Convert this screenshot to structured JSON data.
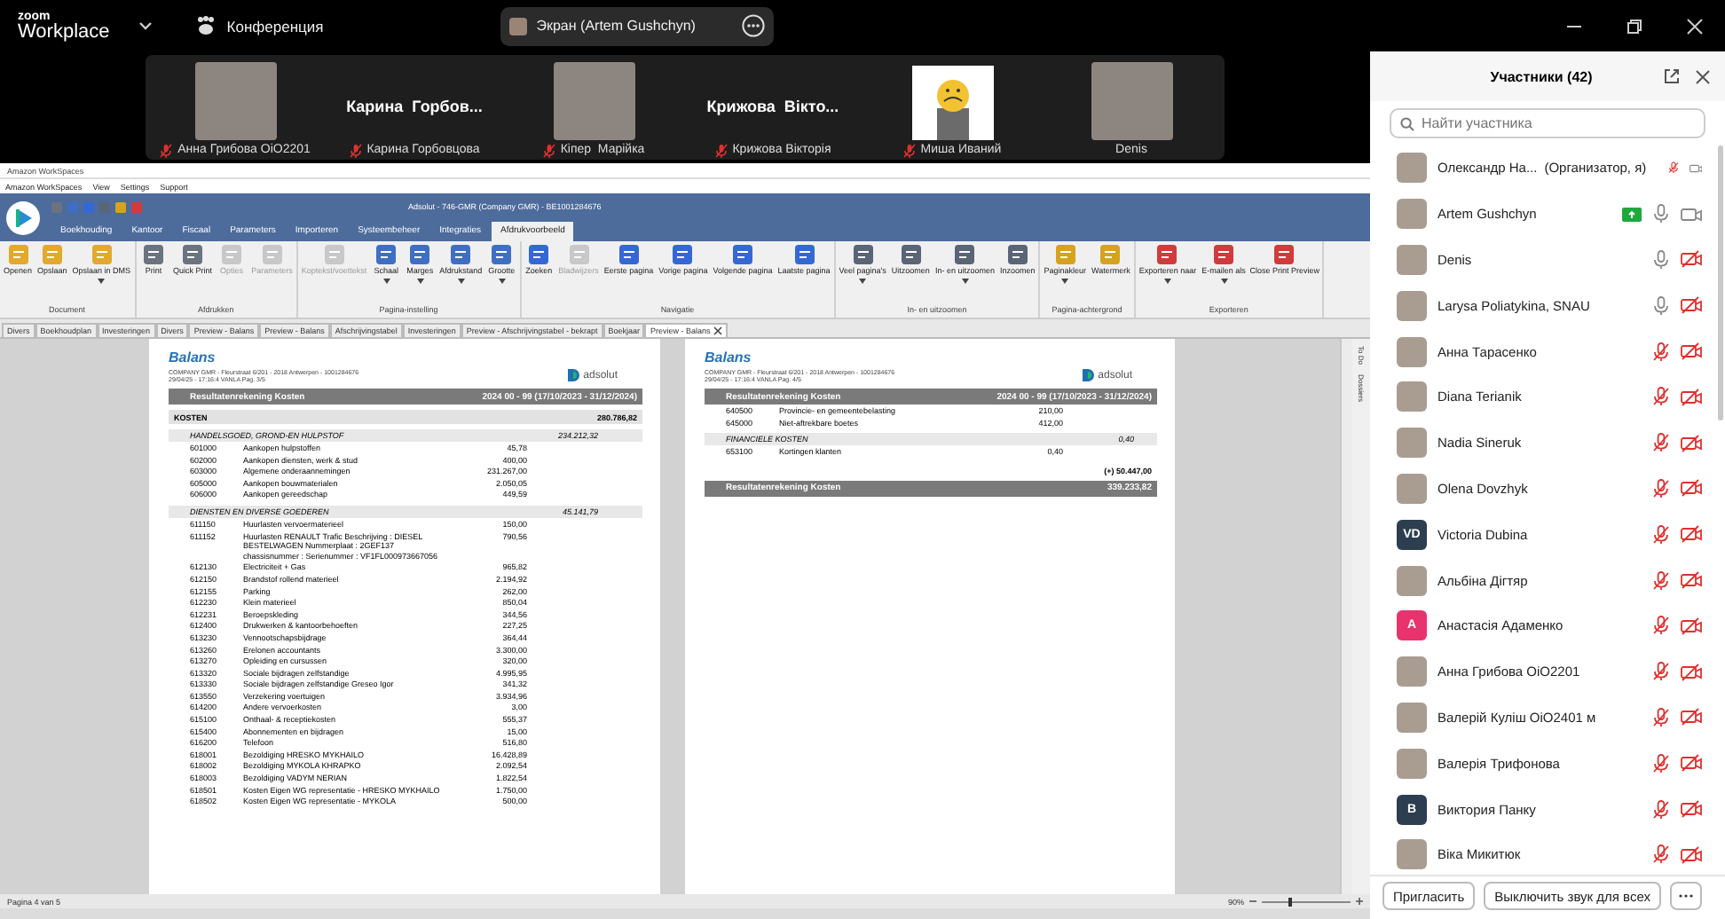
{
  "zoom_bar": {
    "brand_top": "zoom",
    "brand_bottom": "Workplace",
    "meeting_label": "Конференция",
    "share_label": "Экран (Artem Gushchyn)"
  },
  "video_tiles": [
    {
      "kind": "photo",
      "name": "Анна Грибова OiO2201",
      "muted": true
    },
    {
      "kind": "name_card",
      "title": "Карина  Горбов...",
      "name": "Карина Горбовцова",
      "muted": true
    },
    {
      "kind": "photo",
      "name": "Кіпер  Марійка",
      "muted": true
    },
    {
      "kind": "name_card",
      "title": "Крижова  Вікто...",
      "name": "Крижова Вікторія",
      "muted": true
    },
    {
      "kind": "avatar",
      "name": "Миша Иваний",
      "muted": true
    },
    {
      "kind": "photo",
      "name": "Denis",
      "muted": false
    }
  ],
  "workspaces": {
    "title": "Amazon WorkSpaces",
    "menu": [
      "Amazon WorkSpaces",
      "View",
      "Settings",
      "Support"
    ]
  },
  "app": {
    "title": "Adsolut - 746-GMR (Company GMR) - BE1001284676",
    "tabs": [
      {
        "label": "Boekhouding",
        "selected": false
      },
      {
        "label": "Kantoor",
        "selected": false
      },
      {
        "label": "Fiscaal",
        "selected": false
      },
      {
        "label": "Parameters",
        "selected": false
      },
      {
        "label": "Importeren",
        "selected": false
      },
      {
        "label": "Systeembeheer",
        "selected": false
      },
      {
        "label": "Integraties",
        "selected": false
      },
      {
        "label": "Afdrukvoorbeeld",
        "selected": true
      }
    ],
    "ribbon_groups": [
      {
        "label": "Document",
        "buttons": [
          {
            "label": "Openen",
            "disabled": false,
            "menu": false
          },
          {
            "label": "Opslaan",
            "disabled": false,
            "menu": false
          },
          {
            "label": "Opslaan in DMS",
            "disabled": false,
            "menu": true
          }
        ]
      },
      {
        "label": "Afdrukken",
        "buttons": [
          {
            "label": "Print",
            "disabled": false,
            "menu": false
          },
          {
            "label": "Quick Print",
            "disabled": false,
            "menu": false
          },
          {
            "label": "Opties",
            "disabled": true,
            "menu": false
          },
          {
            "label": "Parameters",
            "disabled": true,
            "menu": false
          }
        ]
      },
      {
        "label": "Pagina-instelling",
        "buttons": [
          {
            "label": "Koptekst/voettekst",
            "disabled": true,
            "menu": false
          },
          {
            "label": "Schaal",
            "disabled": false,
            "menu": true
          },
          {
            "label": "Marges",
            "disabled": false,
            "menu": true
          },
          {
            "label": "Afdrukstand",
            "disabled": false,
            "menu": true
          },
          {
            "label": "Grootte",
            "disabled": false,
            "menu": true
          }
        ]
      },
      {
        "label": "Navigatie",
        "buttons": [
          {
            "label": "Zoeken",
            "disabled": false,
            "menu": false
          },
          {
            "label": "Bladwijzers",
            "disabled": true,
            "menu": false
          },
          {
            "label": "Eerste pagina",
            "disabled": false,
            "menu": false
          },
          {
            "label": "Vorige pagina",
            "disabled": false,
            "menu": false
          },
          {
            "label": "Volgende pagina",
            "disabled": false,
            "menu": false
          },
          {
            "label": "Laatste pagina",
            "disabled": false,
            "menu": false
          }
        ]
      },
      {
        "label": "In- en uitzoomen",
        "buttons": [
          {
            "label": "Veel pagina's",
            "disabled": false,
            "menu": true
          },
          {
            "label": "Uitzoomen",
            "disabled": false,
            "menu": false
          },
          {
            "label": "In- en uitzoomen",
            "disabled": false,
            "menu": true
          },
          {
            "label": "Inzoomen",
            "disabled": false,
            "menu": false
          }
        ]
      },
      {
        "label": "Pagina-achtergrond",
        "buttons": [
          {
            "label": "Paginakleur",
            "disabled": false,
            "menu": true
          },
          {
            "label": "Watermerk",
            "disabled": false,
            "menu": false
          }
        ]
      },
      {
        "label": "Exporteren",
        "buttons": [
          {
            "label": "Exporteren naar",
            "disabled": false,
            "menu": true
          },
          {
            "label": "E-mailen als",
            "disabled": false,
            "menu": true
          },
          {
            "label": "Close Print Preview",
            "disabled": false,
            "menu": false
          }
        ]
      }
    ],
    "doc_tabs": [
      {
        "label": "Divers",
        "selected": false
      },
      {
        "label": "Boekhoudplan",
        "selected": false
      },
      {
        "label": "Investeringen",
        "selected": false
      },
      {
        "label": "Divers",
        "selected": false
      },
      {
        "label": "Preview - Balans",
        "selected": false
      },
      {
        "label": "Preview - Balans",
        "selected": false
      },
      {
        "label": "Afschrijvingstabel",
        "selected": false
      },
      {
        "label": "Investeringen",
        "selected": false
      },
      {
        "label": "Preview - Afschrijvingstabel - bekrapt",
        "selected": false
      },
      {
        "label": "Boekjaar",
        "selected": false
      },
      {
        "label": "Preview - Balans",
        "selected": true
      }
    ],
    "pages": [
      {
        "title": "Balans",
        "address": "COMPANY GMR  -  Fleurstraat 6/201  -  2018 Antwerpen  -  1001284676",
        "meta": "29/04/25  -  17:16:4     VANLA     Pag. 3/5",
        "logo": "adsolut",
        "lines": [
          {
            "kind": "band",
            "label": "Resultatenrekening Kosten",
            "value": "2024  00 - 99 (17/10/2023 - 31/12/2024)"
          },
          {
            "kind": "total",
            "label": "KOSTEN",
            "value": "280.786,82"
          },
          {
            "kind": "section",
            "label": "HANDELSGOED, GROND-EN HULPSTOF",
            "value": "234.212,32"
          },
          {
            "kind": "row",
            "code": "601000",
            "label": "Aankopen hulpstoffen",
            "amount": "45,78"
          },
          {
            "kind": "row",
            "code": "602000",
            "label": "Aankopen diensten, werk & stud",
            "amount": "400,00"
          },
          {
            "kind": "row",
            "code": "603000",
            "label": "Algemene onderaannemingen",
            "amount": "231.267,00"
          },
          {
            "kind": "row",
            "code": "605000",
            "label": "Aankopen bouwmaterialen",
            "amount": "2.050,05"
          },
          {
            "kind": "row",
            "code": "606000",
            "label": "Aankopen gereedschap",
            "amount": "449,59"
          },
          {
            "kind": "section",
            "label": "DIENSTEN EN DIVERSE GOEDEREN",
            "value": "45.141,79"
          },
          {
            "kind": "row",
            "code": "611150",
            "label": "Huurlasten vervoermaterieel",
            "amount": "150,00"
          },
          {
            "kind": "row",
            "code": "611152",
            "label": "Huurlasten RENAULT Trafic Beschrijving : DIESEL BESTELWAGEN Nummerplaat : 2GEF137 chassisnummer : Serienummer : VF1FL000973667056",
            "amount": "790,56"
          },
          {
            "kind": "row",
            "code": "612130",
            "label": "Electriciteit + Gas",
            "amount": "965,82"
          },
          {
            "kind": "row",
            "code": "612150",
            "label": "Brandstof rollend materieel",
            "amount": "2.194,92"
          },
          {
            "kind": "row",
            "code": "612155",
            "label": "Parking",
            "amount": "262,00"
          },
          {
            "kind": "row",
            "code": "612230",
            "label": "Klein materieel",
            "amount": "850,04"
          },
          {
            "kind": "row",
            "code": "612231",
            "label": "Beroepskleding",
            "amount": "344,56"
          },
          {
            "kind": "row",
            "code": "612400",
            "label": "Drukwerken & kantoorbehoeften",
            "amount": "227,25"
          },
          {
            "kind": "row",
            "code": "613230",
            "label": "Vennootschapsbijdrage",
            "amount": "364,44"
          },
          {
            "kind": "row",
            "code": "613260",
            "label": "Erelonen accountants",
            "amount": "3.300,00"
          },
          {
            "kind": "row",
            "code": "613270",
            "label": "Opleiding en cursussen",
            "amount": "320,00"
          },
          {
            "kind": "row",
            "code": "613320",
            "label": "Sociale bijdragen zelfstandige",
            "amount": "4.995,95"
          },
          {
            "kind": "row",
            "code": "613330",
            "label": "Sociale bijdragen zelfstandige Greseo Igor",
            "amount": "341,32"
          },
          {
            "kind": "row",
            "code": "613550",
            "label": "Verzekering voertuigen",
            "amount": "3.934,96"
          },
          {
            "kind": "row",
            "code": "614200",
            "label": "Andere vervoerkosten",
            "amount": "3,00"
          },
          {
            "kind": "row",
            "code": "615100",
            "label": "Onthaal- & receptiekosten",
            "amount": "555,37"
          },
          {
            "kind": "row",
            "code": "615400",
            "label": "Abonnementen en bijdragen",
            "amount": "15,00"
          },
          {
            "kind": "row",
            "code": "616200",
            "label": "Telefoon",
            "amount": "516,80"
          },
          {
            "kind": "row",
            "code": "618001",
            "label": "Bezoldiging HRESKO MYKHAILO",
            "amount": "16.428,89"
          },
          {
            "kind": "row",
            "code": "618002",
            "label": "Bezoldiging MYKOLA KHRAPKO",
            "amount": "2.092,54"
          },
          {
            "kind": "row",
            "code": "618003",
            "label": "Bezoldiging VADYM NERIAN",
            "amount": "1.822,54"
          },
          {
            "kind": "row",
            "code": "618501",
            "label": "Kosten Eigen WG representatie - HRESKO MYKHAILO",
            "amount": "1.750,00"
          },
          {
            "kind": "row",
            "code": "618502",
            "label": "Kosten Eigen WG representatie - MYKOLA",
            "amount": "500,00"
          }
        ]
      },
      {
        "title": "Balans",
        "address": "COMPANY GMR  -  Fleurstraat 6/201  -  2018 Antwerpen  -  1001284676",
        "meta": "29/04/25  -  17:16:4     VANLA     Pag. 4/5",
        "logo": "adsolut",
        "lines": [
          {
            "kind": "band",
            "label": "Resultatenrekening Kosten",
            "value": "2024  00 - 99 (17/10/2023 - 31/12/2024)"
          },
          {
            "kind": "row",
            "code": "640500",
            "label": "Provincie- en gemeentebelasting",
            "amount": "210,00"
          },
          {
            "kind": "row",
            "code": "645000",
            "label": "Niet-aftrekbare boetes",
            "amount": "412,00"
          },
          {
            "kind": "section",
            "label": "FINANCIELE KOSTEN",
            "value": "0,40"
          },
          {
            "kind": "row",
            "code": "653100",
            "label": "Kortingen klanten",
            "amount": "0,40"
          },
          {
            "kind": "subtotal",
            "value": "(+) 50.447,00"
          },
          {
            "kind": "band",
            "label": "Resultatenrekening Kosten",
            "value": "339.233,82"
          }
        ]
      }
    ],
    "side_tabs": [
      "To Do",
      "Dossiers"
    ],
    "status": {
      "page_info": "Pagina 4 van 5",
      "zoom": "90%",
      "zoom_slider": {
        "level": 0.3
      }
    }
  },
  "participants": {
    "title": "Участники (42)",
    "search": {
      "placeholder": "Найти участника"
    },
    "list": [
      {
        "name": "Олександр На...",
        "role": "(Организатор, я)",
        "kind": "photo",
        "sharing": false,
        "muted": true,
        "video_off": false
      },
      {
        "name": "Artem Gushchyn",
        "kind": "photo",
        "sharing": true,
        "muted": false,
        "video_off": false
      },
      {
        "name": "Denis",
        "kind": "photo",
        "sharing": false,
        "muted": false,
        "video_off": true
      },
      {
        "name": "Larysa Poliatykina, SNAU",
        "kind": "photo",
        "sharing": false,
        "muted": false,
        "video_off": true
      },
      {
        "name": "Анна Тарасенко",
        "kind": "photo",
        "sharing": false,
        "muted": true,
        "video_off": true
      },
      {
        "name": "Diana Terianik",
        "kind": "photo",
        "sharing": false,
        "muted": true,
        "video_off": true
      },
      {
        "name": "Nadia Sineruk",
        "kind": "photo",
        "sharing": false,
        "muted": true,
        "video_off": true
      },
      {
        "name": "Olena Dovzhyk",
        "kind": "photo",
        "sharing": false,
        "muted": true,
        "video_off": true
      },
      {
        "name": "Victoria Dubina",
        "kind": "initials",
        "initials": "VD",
        "color": "#2c3e50",
        "sharing": false,
        "muted": true,
        "video_off": true
      },
      {
        "name": "Альбіна Дігтяр",
        "kind": "photo",
        "sharing": false,
        "muted": true,
        "video_off": true
      },
      {
        "name": "Анастасія Адаменко",
        "kind": "initials",
        "initials": "A",
        "color": "#e8336f",
        "sharing": false,
        "muted": true,
        "video_off": true
      },
      {
        "name": "Анна Грибова OiO2201",
        "kind": "photo",
        "sharing": false,
        "muted": true,
        "video_off": true
      },
      {
        "name": "Валерій Куліш OiO2401 м",
        "kind": "photo",
        "sharing": false,
        "muted": true,
        "video_off": true
      },
      {
        "name": "Валерія Трифонова",
        "kind": "photo",
        "sharing": false,
        "muted": true,
        "video_off": true
      },
      {
        "name": "Виктория Панку",
        "kind": "initials",
        "initials": "В",
        "color": "#2c3e50",
        "sharing": false,
        "muted": true,
        "video_off": true
      },
      {
        "name": "Віка Микитюк",
        "kind": "photo",
        "sharing": false,
        "muted": true,
        "video_off": true
      }
    ],
    "buttons": [
      "Пригласить",
      "Выключить звук для всех"
    ]
  }
}
